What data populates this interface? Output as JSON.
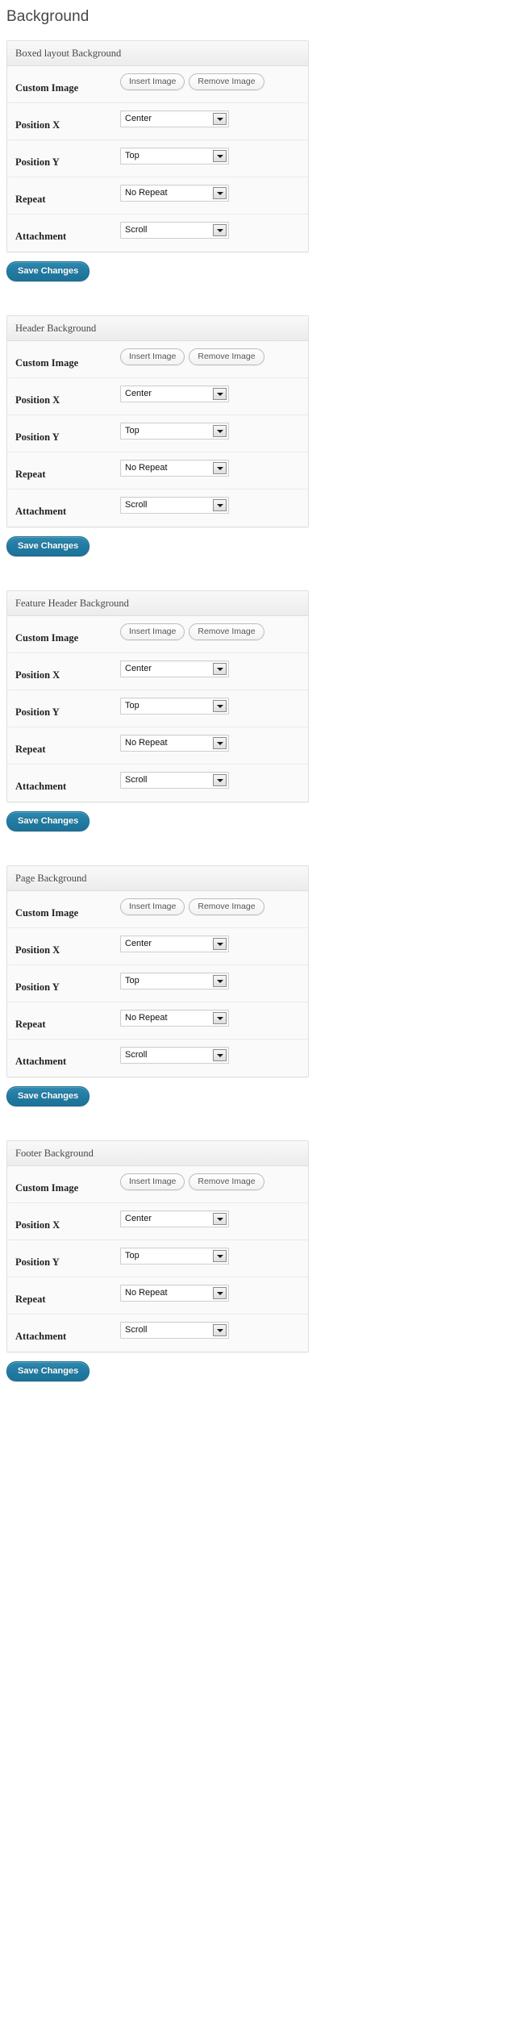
{
  "page": {
    "title": "Background"
  },
  "labels": {
    "custom_image": "Custom Image",
    "position_x": "Position X",
    "position_y": "Position Y",
    "repeat": "Repeat",
    "attachment": "Attachment"
  },
  "buttons": {
    "insert_image": "Insert Image",
    "remove_image": "Remove Image",
    "save_changes": "Save Changes"
  },
  "values": {
    "position_x": "Center",
    "position_y": "Top",
    "repeat": "No Repeat",
    "attachment": "Scroll"
  },
  "colors": {
    "accent": "#217ba3",
    "panel_border": "#dfdfdf",
    "panel_bg": "#fafafa",
    "header_bg": "#ececec",
    "text": "#222222",
    "title_text": "#464646"
  },
  "sections": [
    {
      "header": "Boxed layout Background"
    },
    {
      "header": "Header Background"
    },
    {
      "header": "Feature Header Background"
    },
    {
      "header": "Page Background"
    },
    {
      "header": "Footer Background"
    }
  ]
}
